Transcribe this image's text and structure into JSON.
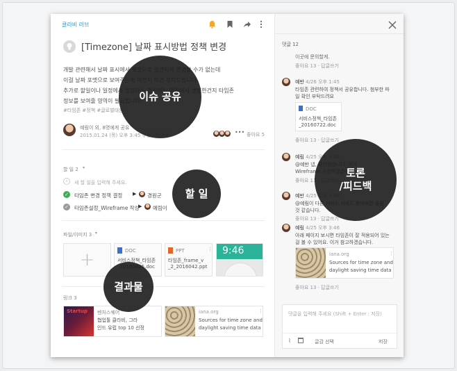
{
  "header": {
    "workspace": "클라비 러브"
  },
  "post": {
    "title": "[Timezone] 날짜 표시방법 정책 변경",
    "body": [
      "개발 관련해서 날짜 표시에서 포맷으로 일관되게 변경할 수가 없는데",
      "이걸 날짜 포맷으로 보여주는게 어떤지 의견 부탁드립니다.",
      "추가로 할일이나 일정에서 설정하는 경우에는 이쪽에서 셋팅한건지 타임존",
      "정보를 보여줄 영역이 필요합니다."
    ],
    "tags": "#타임존 #정책 #글로벌대응",
    "author": "예림이 외, 8명에게 공유",
    "date": "2015.01.24 (목) 오후 3:45 수정 · 라이언",
    "likes": "좋아요 5"
  },
  "todos": {
    "header": "할 일 2",
    "placeholder": "새 할 일을 입력해 주세요.",
    "items": [
      {
        "text": "타임존 변경 정책 결정",
        "assignee": "경원군"
      },
      {
        "text": "타임존설정_Wireframe 작성",
        "assignee": "예림이"
      }
    ]
  },
  "files": {
    "header": "파일/이미지 3",
    "items": [
      {
        "type": "DOC",
        "name1": "서비스정책_타임존",
        "name2": "_20160425.doc"
      },
      {
        "type": "PPT",
        "name1": "타임존_frame_v",
        "name2": "_2_2016042.ppt"
      }
    ],
    "clock": "9:46"
  },
  "links": {
    "header": "링크 3",
    "items": [
      {
        "thumb": "Startup",
        "title1": "벤처스퀘어",
        "title2": "협업툴 클라비, 그라",
        "title3": "인드 유럽 top 10 선정"
      },
      {
        "site": "iana.org",
        "title1": "Sources for time zone and",
        "title2": "daylight saving time data"
      }
    ]
  },
  "comments": {
    "count": "댓글 12",
    "top_partial": "이곳에 문의할게.",
    "top_meta": "좋아요 13 · 답글쓰기",
    "items": [
      {
        "author": "예반",
        "date": "4/26 오후 1:45",
        "lines": [
          "타임존 관련하여 정책서 공유합니다. 첨부한 파",
          "일 확인 부탁드려요"
        ],
        "file_type": "DOC",
        "file_name1": "서비스정책_타임존",
        "file_name2": "_20160722.doc",
        "meta": "좋아요 13 · 답글쓰기"
      },
      {
        "author": "예림",
        "date": "4/25 오후 3:46",
        "lines": [
          "@예반 넵, 확인했습니다. 이거",
          "Wireframe 수정하겠습니다."
        ],
        "meta": "좋아요 13 · 답글쓰기"
      },
      {
        "author": "예반",
        "date": "4/25 오후 3:46",
        "lines": [
          "@예림이 다른 서비스 사례도 찾아보면 좋을",
          "것 같습니다."
        ],
        "meta": "좋아요 13 · 답글쓰기"
      },
      {
        "author": "예림",
        "date": "4/25 오후 3:46",
        "lines": [
          "아래 페이지 보시면 타임존이 잘 적용되어 있는",
          "걸 볼 수 있어요. 이거 참고하겠습니다."
        ],
        "link_site": "iana.org",
        "link_title1": "Sources for time zone and",
        "link_title2": "daylight saving time data",
        "meta": "좋아요 13 · 답글쓰기"
      }
    ],
    "input_placeholder": "댓글을 입력해 주세요 (Shift + Enter : 저장)",
    "input_option": "글감 선택",
    "save_label": "저장"
  },
  "overlays": {
    "issue": "이슈 공유",
    "todo": "할 일",
    "result": "결과물",
    "discussion_line1": "토론",
    "discussion_line2": "/피드백"
  },
  "colors": {
    "accent": "#2a9fd6",
    "bell": "#f5a623",
    "check": "#3dae56",
    "overlay": "#1c1c1c"
  }
}
